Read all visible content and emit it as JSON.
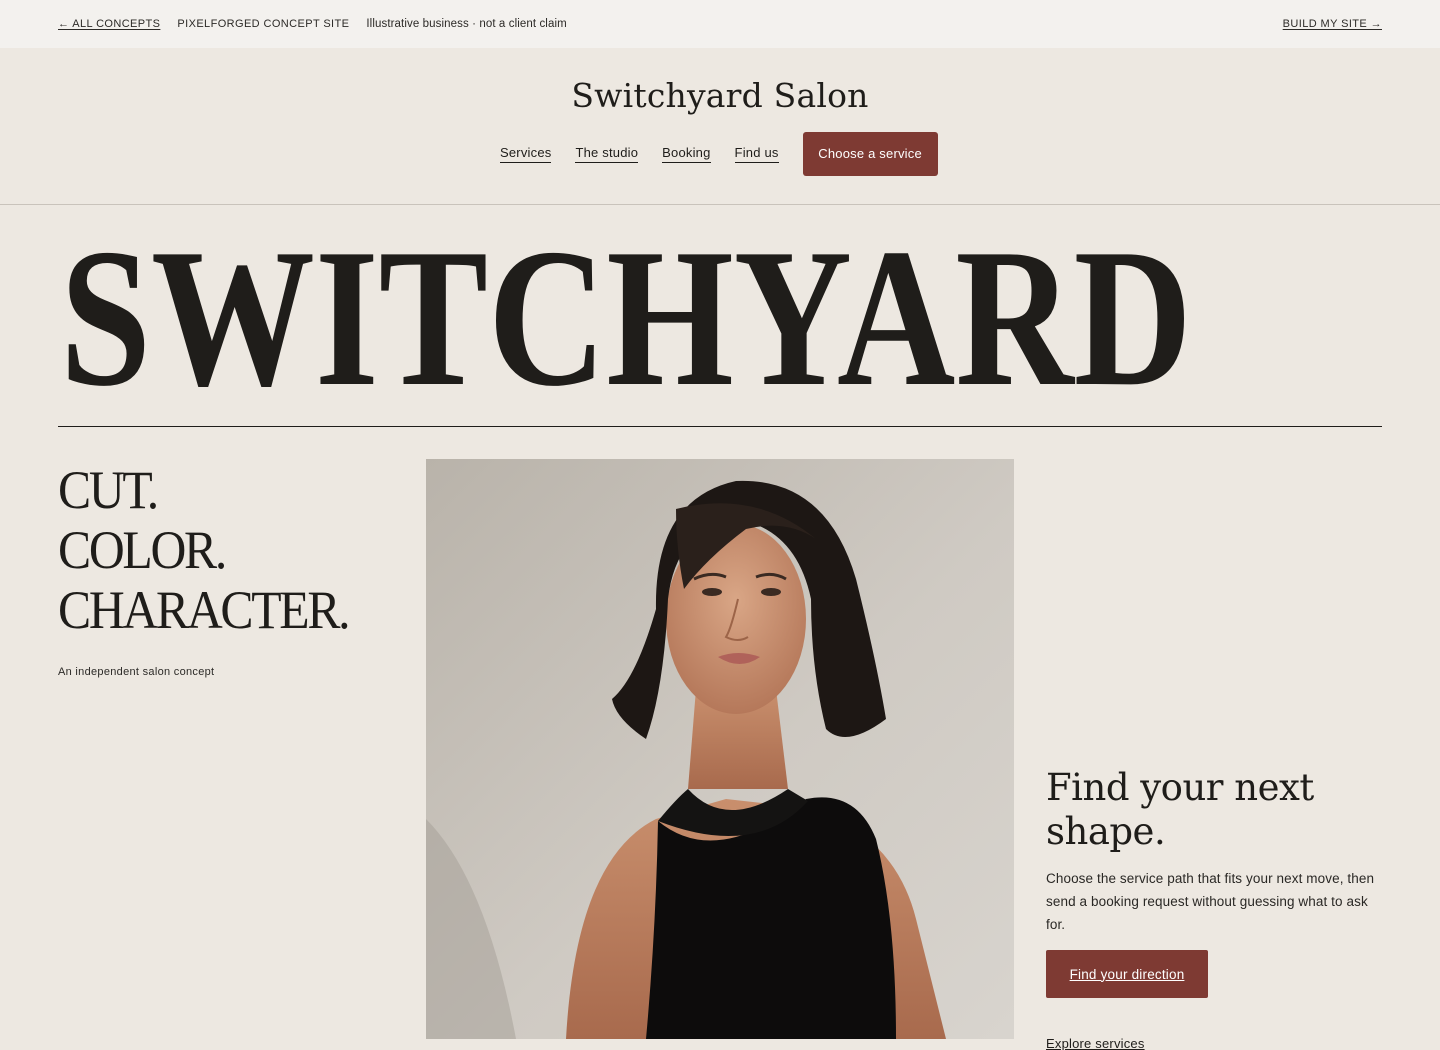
{
  "concept_bar": {
    "back_link": "← ALL CONCEPTS",
    "site_label": "PIXELFORGED CONCEPT SITE",
    "note": "Illustrative business · not a client claim",
    "build_link": "BUILD MY SITE →"
  },
  "header": {
    "brand": "Switchyard Salon",
    "nav": [
      "Services",
      "The studio",
      "Booking",
      "Find us"
    ],
    "cta": "Choose a service"
  },
  "hero": {
    "wordmark": "SWITCHYARD",
    "tagline": [
      "CUT.",
      "COLOR.",
      "CHARACTER."
    ],
    "subline": "An independent salon concept",
    "photo_alt": "Portrait of a woman with a dark bob haircut wearing a black sleeveless top",
    "find_title": "Find your next shape.",
    "find_text": "Choose the service path that fits your next move, then send a booking request without guessing what to ask for.",
    "find_button": "Find your direction",
    "explore_link": "Explore services"
  },
  "colors": {
    "background": "#ede8e1",
    "accent": "#7e3a33",
    "ink": "#1f1d1a"
  }
}
